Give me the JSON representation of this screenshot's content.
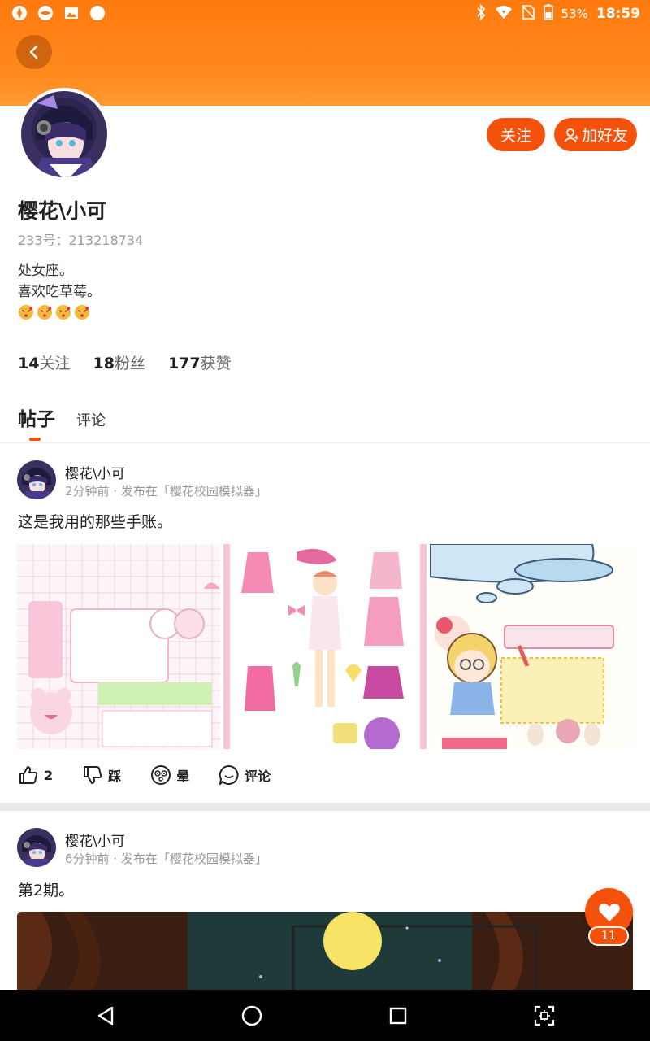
{
  "status_bar": {
    "battery": "53%",
    "time": "18:59",
    "left_icons": [
      "app-icon",
      "app-icon",
      "image-icon",
      "circle-icon"
    ],
    "right_icons": [
      "bluetooth-icon",
      "wifi-icon",
      "no-sim-icon",
      "battery-icon"
    ]
  },
  "header": {
    "back_icon": "chevron-left-icon",
    "color": "#ff7a0f"
  },
  "profile": {
    "name": "樱花\\小可",
    "uid": "233号：213218734",
    "bio_line1": "处女座。",
    "bio_line2": "喜欢吃草莓。",
    "bio_emoji_count": 4,
    "follow_label": "关注",
    "add_friend_label": "加好友"
  },
  "stats": {
    "following_count": "14",
    "following_label": "关注",
    "followers_count": "18",
    "followers_label": "粉丝",
    "likes_count": "177",
    "likes_label": "获赞"
  },
  "tabs": {
    "posts": "帖子",
    "comments": "评论"
  },
  "posts": [
    {
      "author": "樱花\\小可",
      "meta": "2分钟前 · 发布在「樱花校园模拟器」",
      "text": "这是我用的那些手账。",
      "actions": {
        "like_count": "2",
        "dislike_label": "踩",
        "dizzy_label": "晕",
        "comment_label": "评论"
      }
    },
    {
      "author": "樱花\\小可",
      "meta": "6分钟前 · 发布在「樱花校园模拟器」",
      "text": "第2期。"
    }
  ],
  "fab": {
    "count": "11",
    "icon": "heart-icon"
  },
  "nav": [
    "back-triangle-icon",
    "home-circle-icon",
    "recents-square-icon",
    "screenshot-icon"
  ],
  "colors": {
    "accent": "#f4520c",
    "header": "#ff7a0f"
  }
}
